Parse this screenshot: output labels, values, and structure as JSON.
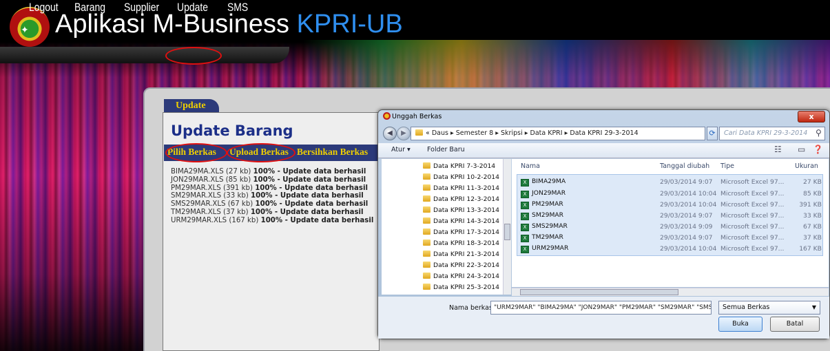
{
  "app": {
    "title_main": "Aplikasi M-Business ",
    "title_accent": "KPRI-UB"
  },
  "menu": {
    "items": [
      "Logout",
      "Barang",
      "Supplier",
      "Update",
      "SMS"
    ]
  },
  "panel": {
    "tab_label": "Update",
    "heading": "Update Barang",
    "buttons": {
      "pick": "Pilih Berkas",
      "upload": "Upload Berkas",
      "clear": "Bersihkan Berkas"
    },
    "log": [
      {
        "file": "BIMA29MA.XLS (27 kb) ",
        "pct": "100%",
        "msg": " - Update data berhasil"
      },
      {
        "file": "JON29MAR.XLS (85 kb) ",
        "pct": "100%",
        "msg": " - Update data berhasil"
      },
      {
        "file": "PM29MAR.XLS (391 kb) ",
        "pct": "100%",
        "msg": " - Update data berhasil"
      },
      {
        "file": "SM29MAR.XLS (33 kb) ",
        "pct": "100%",
        "msg": " - Update data berhasil"
      },
      {
        "file": "SMS29MAR.XLS (67 kb) ",
        "pct": "100%",
        "msg": " - Update data berhasil"
      },
      {
        "file": "TM29MAR.XLS (37 kb) ",
        "pct": "100%",
        "msg": " - Update data berhasil"
      },
      {
        "file": "URM29MAR.XLS (167 kb) ",
        "pct": "100%",
        "msg": " - Update data berhasil"
      }
    ]
  },
  "dialog": {
    "title": "Unggah Berkas",
    "close": "x",
    "address": "« Daus ▸ Semester 8 ▸ Skripsi ▸ Data KPRI ▸ Data KPRI 29-3-2014",
    "search_placeholder": "Cari Data KPRI 29-3-2014",
    "toolbar": {
      "organize": "Atur ▾",
      "new_folder": "Folder Baru"
    },
    "folders": [
      "Data KPRI 7-3-2014",
      "Data KPRI 10-2-2014",
      "Data KPRI 11-3-2014",
      "Data KPRI 12-3-2014",
      "Data KPRI 13-3-2014",
      "Data KPRI 14-3-2014",
      "Data KPRI 17-3-2014",
      "Data KPRI 18-3-2014",
      "Data KPRI 21-3-2014",
      "Data KPRI 22-3-2014",
      "Data KPRI 24-3-2014",
      "Data KPRI 25-3-2014"
    ],
    "columns": {
      "name": "Nama",
      "date": "Tanggal diubah",
      "type": "Tipe",
      "size": "Ukuran"
    },
    "files": [
      {
        "name": "BIMA29MA",
        "date": "29/03/2014 9:07",
        "type": "Microsoft Excel 97...",
        "size": "27 KB"
      },
      {
        "name": "JON29MAR",
        "date": "29/03/2014 10:04",
        "type": "Microsoft Excel 97...",
        "size": "85 KB"
      },
      {
        "name": "PM29MAR",
        "date": "29/03/2014 10:04",
        "type": "Microsoft Excel 97...",
        "size": "391 KB"
      },
      {
        "name": "SM29MAR",
        "date": "29/03/2014 9:07",
        "type": "Microsoft Excel 97...",
        "size": "33 KB"
      },
      {
        "name": "SMS29MAR",
        "date": "29/03/2014 9:09",
        "type": "Microsoft Excel 97...",
        "size": "67 KB"
      },
      {
        "name": "TM29MAR",
        "date": "29/03/2014 9:07",
        "type": "Microsoft Excel 97...",
        "size": "37 KB"
      },
      {
        "name": "URM29MAR",
        "date": "29/03/2014 10:04",
        "type": "Microsoft Excel 97...",
        "size": "167 KB"
      }
    ],
    "filename_label": "Nama berkas:",
    "filename_value": "\"URM29MAR\" \"BIMA29MA\" \"JON29MAR\" \"PM29MAR\" \"SM29MAR\" \"SMS",
    "filetype": "Semua Berkas",
    "open": "Buka",
    "cancel": "Batal"
  },
  "colors": {
    "accent": "#2f8ff0",
    "panel_nav": "#2c3a7a",
    "button_text": "#f0d000",
    "highlight_oval": "#e01010"
  }
}
